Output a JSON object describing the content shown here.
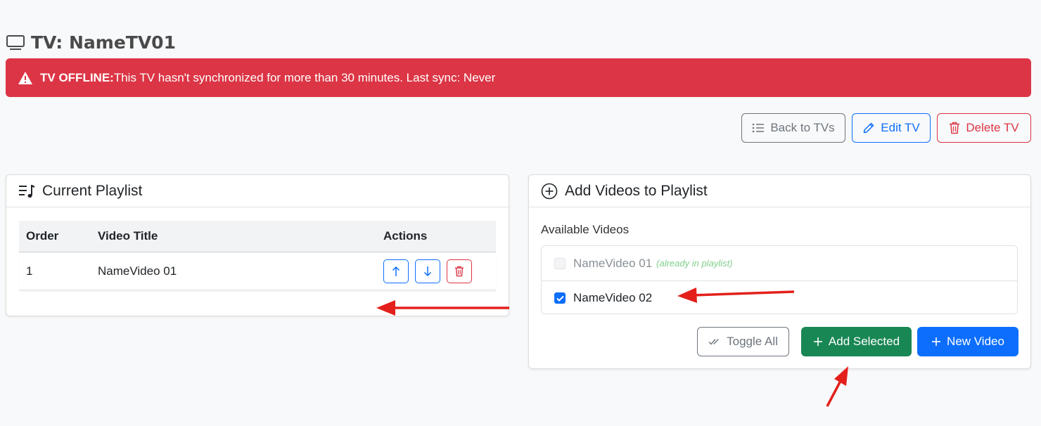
{
  "header": {
    "title": "TV: NameTV01",
    "icon": "tv-icon"
  },
  "alert": {
    "strong": "TV OFFLINE:",
    "message": "This TV hasn't synchronized for more than 30 minutes. Last sync: Never",
    "color": "#dc3545"
  },
  "toolbar": {
    "back_label": "Back to TVs",
    "edit_label": "Edit TV",
    "delete_label": "Delete TV"
  },
  "playlist": {
    "title": "Current Playlist",
    "columns": [
      "Order",
      "Video Title",
      "Actions"
    ],
    "rows": [
      {
        "order": "1",
        "title": "NameVideo 01"
      }
    ]
  },
  "add_videos": {
    "title": "Add Videos to Playlist",
    "available_label": "Available Videos",
    "items": [
      {
        "name": "NameVideo 01",
        "note": "(already in playlist)",
        "checked": false,
        "disabled": true
      },
      {
        "name": "NameVideo 02",
        "note": "",
        "checked": true,
        "disabled": false
      }
    ],
    "toggle_all_label": "Toggle All",
    "add_selected_label": "Add Selected",
    "new_video_label": "New Video"
  },
  "colors": {
    "primary": "#0d6efd",
    "success": "#198754",
    "danger": "#dc3545",
    "secondary": "#6c757d",
    "annotation_arrow": "#e3201b"
  }
}
